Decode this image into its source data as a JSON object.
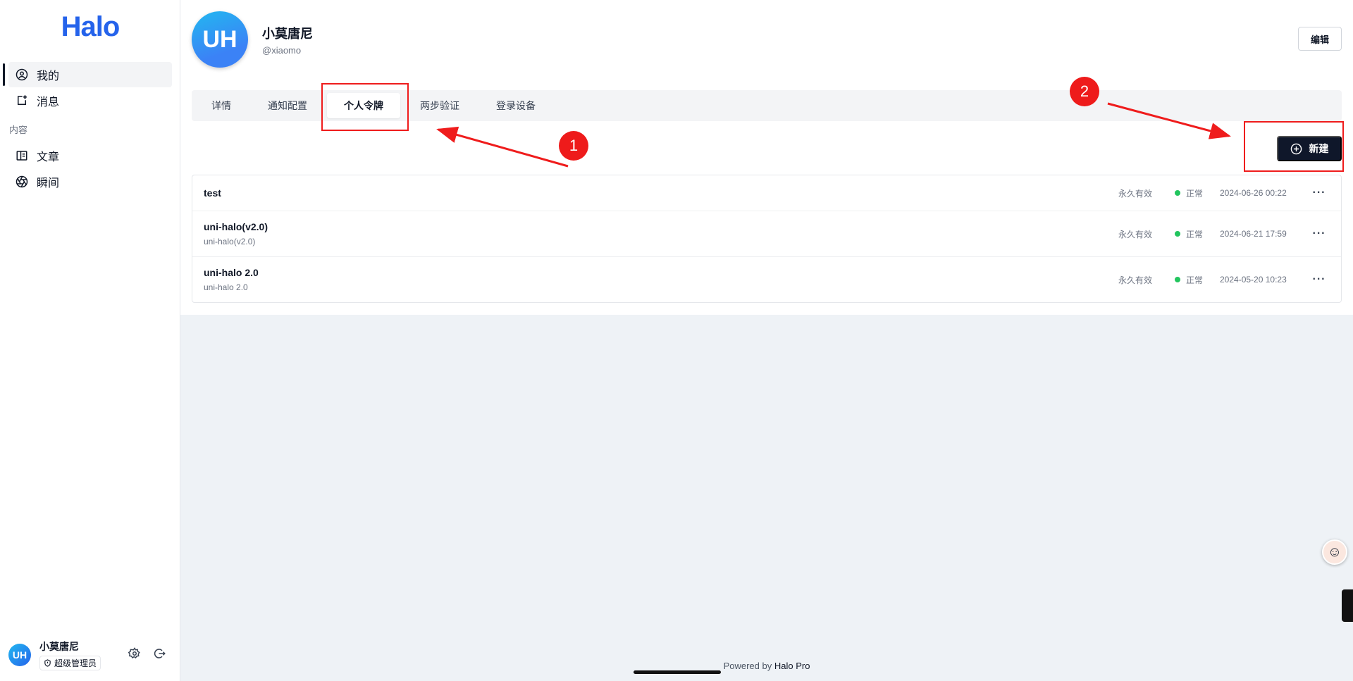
{
  "sidebar": {
    "logo": "Halo",
    "items": [
      {
        "label": "我的",
        "icon": "user-circle-icon",
        "active": true
      },
      {
        "label": "消息",
        "icon": "notification-icon",
        "active": false
      }
    ],
    "group_label": "内容",
    "content_items": [
      {
        "label": "文章",
        "icon": "book-icon"
      },
      {
        "label": "瞬间",
        "icon": "aperture-icon"
      }
    ],
    "user": {
      "avatar_text": "UH",
      "name": "小莫唐尼",
      "role": "超级管理员"
    }
  },
  "profile": {
    "avatar_text": "UH",
    "name": "小莫唐尼",
    "handle": "@xiaomo",
    "edit_label": "编辑"
  },
  "tabs": [
    {
      "label": "详情",
      "active": false
    },
    {
      "label": "通知配置",
      "active": false
    },
    {
      "label": "个人令牌",
      "active": true
    },
    {
      "label": "两步验证",
      "active": false
    },
    {
      "label": "登录设备",
      "active": false
    }
  ],
  "new_button_label": "新建",
  "tokens": [
    {
      "name": "test",
      "description": "",
      "expiry": "永久有效",
      "status": "正常",
      "date": "2024-06-26 00:22"
    },
    {
      "name": "uni-halo(v2.0)",
      "description": "uni-halo(v2.0)",
      "expiry": "永久有效",
      "status": "正常",
      "date": "2024-06-21 17:59"
    },
    {
      "name": "uni-halo 2.0",
      "description": "uni-halo 2.0",
      "expiry": "永久有效",
      "status": "正常",
      "date": "2024-05-20 10:23"
    }
  ],
  "footer": {
    "prefix": "Powered by",
    "brand": "Halo Pro"
  },
  "annotations": [
    {
      "number": "1"
    },
    {
      "number": "2"
    }
  ],
  "colors": {
    "accent": "#2563eb",
    "primary_button": "#0f172a",
    "status_ok": "#22c55e",
    "annotation": "#ef1c1c"
  }
}
